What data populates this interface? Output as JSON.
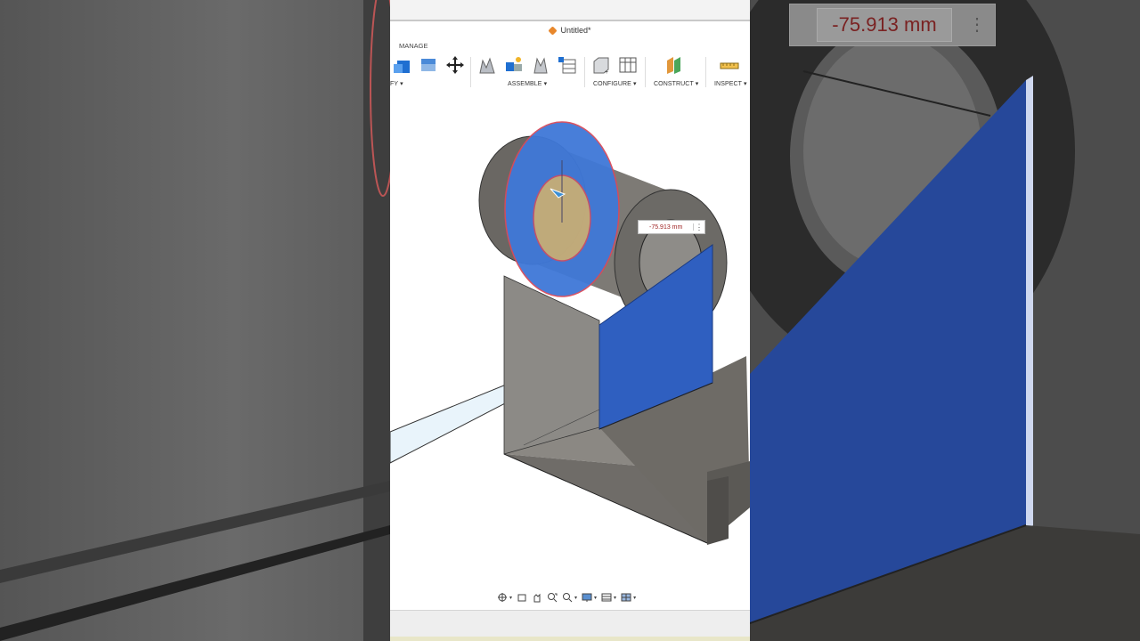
{
  "document": {
    "title": "Untitled*"
  },
  "toolbar": {
    "tab_label": "MANAGE",
    "groups": [
      {
        "label": "FY ▾"
      },
      {
        "label": "ASSEMBLE ▾"
      },
      {
        "label": "CONFIGURE ▾"
      },
      {
        "label": "CONSTRUCT ▾"
      },
      {
        "label": "INSPECT ▾"
      }
    ]
  },
  "dimension": {
    "value": "-75.913 mm"
  },
  "zoomed_dimension": {
    "value": "-75.913 mm"
  },
  "colors": {
    "accent_blue": "#2f6fd6",
    "body_gray": "#77746f",
    "dimension_red": "#a02525"
  },
  "nav_icons": [
    "orbit-icon",
    "look-at-icon",
    "pan-icon",
    "zoom-window-icon",
    "zoom-icon",
    "display-settings-icon",
    "grid-icon",
    "viewports-icon"
  ]
}
